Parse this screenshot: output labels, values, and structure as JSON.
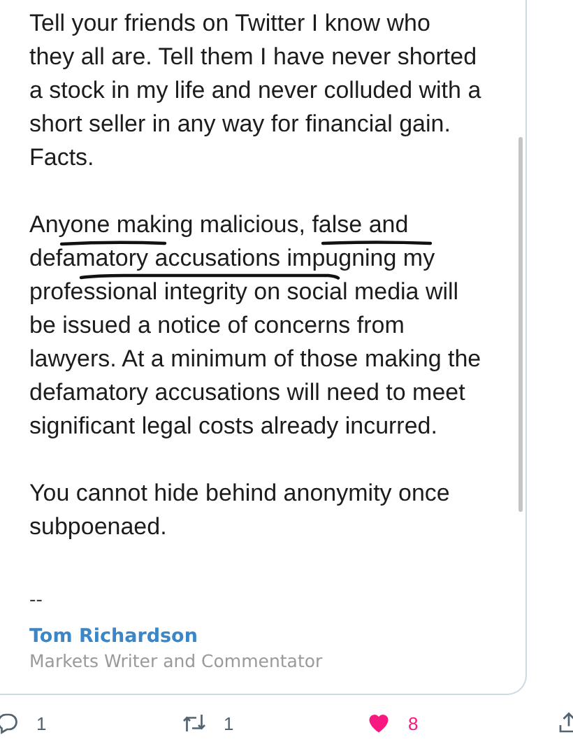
{
  "email": {
    "paragraphs": [
      {
        "lines": [
          "Tell your friends on Twitter I know who",
          "they all are. Tell them I have never shorted",
          "a stock in my life and never colluded with a",
          "short seller in any way for financial gain.",
          "Facts."
        ],
        "marked": false
      },
      {
        "lines": [
          "Anyone making malicious, false and",
          "defamatory accusations impugning my",
          "professional integrity on social media will",
          "be issued a notice of concerns from",
          "lawyers. At a minimum of those making the",
          "defamatory accusations will need to meet",
          "significant legal costs already incurred."
        ],
        "marked": true
      },
      {
        "lines": [
          "You cannot hide behind anonymity once",
          "subpoenaed."
        ],
        "marked": false
      }
    ],
    "signature": {
      "separator": "--",
      "name": "Tom Richardson",
      "role": "Markets Writer and Commentator"
    }
  },
  "actions": [
    {
      "kind": "reply",
      "count": "1"
    },
    {
      "kind": "retweet",
      "count": "1"
    },
    {
      "kind": "like",
      "count": "8",
      "liked": true
    },
    {
      "kind": "share"
    }
  ]
}
